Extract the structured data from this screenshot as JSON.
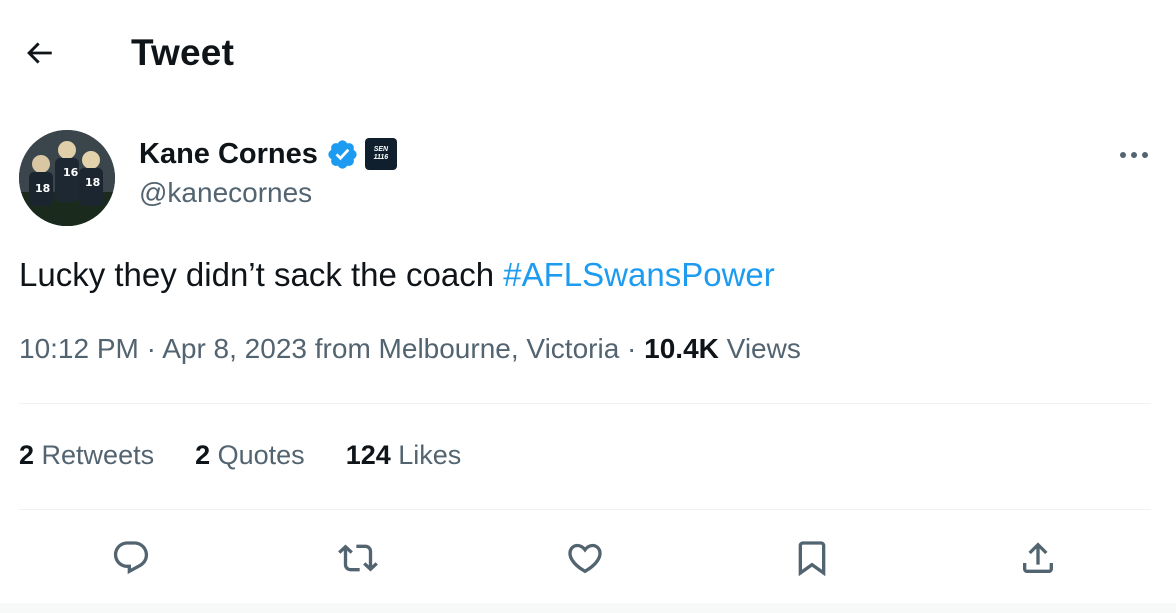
{
  "header": {
    "title": "Tweet",
    "back_icon": "arrow-left-icon"
  },
  "author": {
    "display_name": "Kane Cornes",
    "handle": "@kanecornes",
    "verified_color": "#1d9bf0",
    "affiliate_badge_text_1": "SEN",
    "affiliate_badge_text_2": "1116"
  },
  "tweet": {
    "text": "Lucky they didn’t sack the coach ",
    "hashtag": "#AFLSwansPower"
  },
  "meta": {
    "time": "10:12 PM",
    "separator": " · ",
    "date": "Apr 8, 2023",
    "location": " from Melbourne, Victoria",
    "views_count": "10.4K",
    "views_label": " Views"
  },
  "stats": {
    "retweets_count": "2",
    "retweets_label": " Retweets",
    "quotes_count": "2",
    "quotes_label": " Quotes",
    "likes_count": "124",
    "likes_label": " Likes"
  },
  "actions": [
    "reply-icon",
    "retweet-icon",
    "like-icon",
    "bookmark-icon",
    "share-icon"
  ],
  "colors": {
    "text_primary": "#0f1419",
    "text_secondary": "#536471",
    "link": "#1d9bf0",
    "divider": "#eff3f4"
  }
}
